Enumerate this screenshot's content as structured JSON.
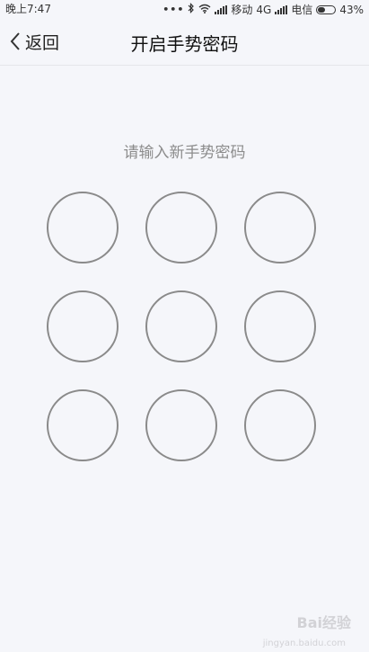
{
  "status_bar": {
    "time": "晚上7:47",
    "carrier1": "移动",
    "network": "4G",
    "carrier2": "电信",
    "battery_percent": "43%",
    "battery_level": 0.43,
    "icons": [
      "more-dots-icon",
      "bluetooth-icon",
      "wifi-icon",
      "signal-icon",
      "signal-icon",
      "battery-icon"
    ]
  },
  "header": {
    "back_label": "返回",
    "title": "开启手势密码"
  },
  "prompt": "请输入新手势密码",
  "gesture_grid": {
    "rows": 3,
    "cols": 3,
    "circle_color": "#8a8a8a"
  },
  "watermark": {
    "text": "Bai经验",
    "sub": "jingyan.baidu.com"
  },
  "colors": {
    "background": "#f5f6fa",
    "prompt_text": "#8c8c8c"
  }
}
